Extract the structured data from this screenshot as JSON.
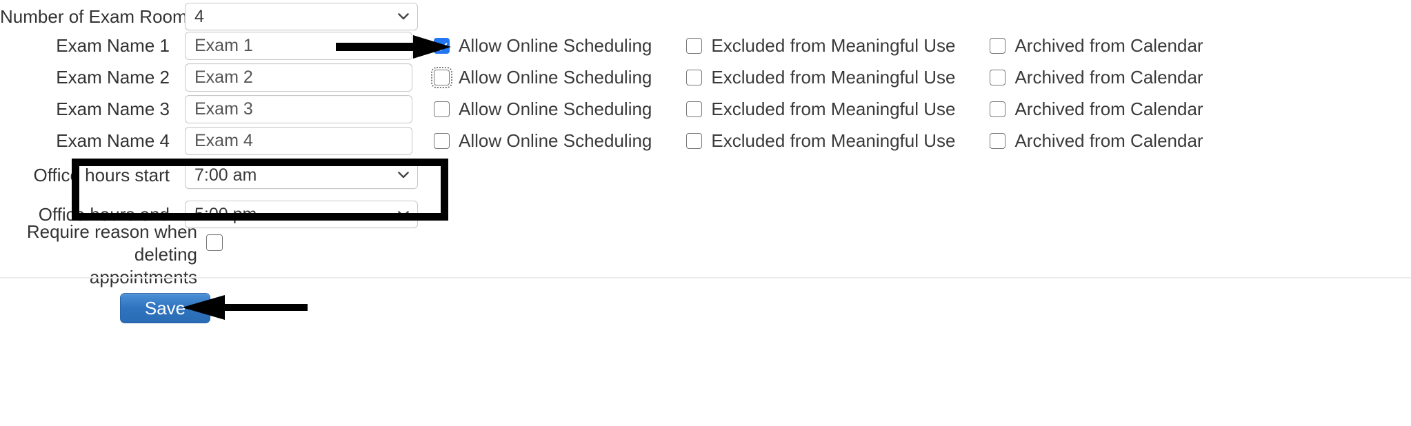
{
  "form": {
    "exam_rooms": {
      "label": "Number of Exam Rooms",
      "value": "4"
    },
    "exam_rows": [
      {
        "label": "Exam Name 1",
        "value": "Exam 1",
        "allow_online_label": "Allow Online Scheduling",
        "allow_online_checked": true,
        "allow_online_focused": false,
        "excluded_label": "Excluded from Meaningful Use",
        "excluded_checked": false,
        "archived_label": "Archived from Calendar",
        "archived_checked": false
      },
      {
        "label": "Exam Name 2",
        "value": "Exam 2",
        "allow_online_label": "Allow Online Scheduling",
        "allow_online_checked": false,
        "allow_online_focused": true,
        "excluded_label": "Excluded from Meaningful Use",
        "excluded_checked": false,
        "archived_label": "Archived from Calendar",
        "archived_checked": false
      },
      {
        "label": "Exam Name 3",
        "value": "Exam 3",
        "allow_online_label": "Allow Online Scheduling",
        "allow_online_checked": false,
        "allow_online_focused": false,
        "excluded_label": "Excluded from Meaningful Use",
        "excluded_checked": false,
        "archived_label": "Archived from Calendar",
        "archived_checked": false
      },
      {
        "label": "Exam Name 4",
        "value": "Exam 4",
        "allow_online_label": "Allow Online Scheduling",
        "allow_online_checked": false,
        "allow_online_focused": false,
        "excluded_label": "Excluded from Meaningful Use",
        "excluded_checked": false,
        "archived_label": "Archived from Calendar",
        "archived_checked": false
      }
    ],
    "office_hours_start": {
      "label": "Office hours start",
      "value": "7:00 am"
    },
    "office_hours_end": {
      "label": "Office hours end",
      "value": "5:00 pm"
    },
    "require_reason": {
      "label_line1": "Require reason when deleting",
      "label_line2": "appointments",
      "checked": false
    }
  },
  "actions": {
    "save_label": "Save"
  },
  "annotations": {
    "arrow_to_checkbox": "black-right-arrow",
    "arrow_to_save": "black-left-arrow",
    "highlight_box": "black-rectangle-around-office-hours"
  },
  "colors": {
    "checkbox_checked": "#2477f2",
    "save_button": "#2f73bf",
    "annotation": "#000000",
    "field_border": "#c8c8c8",
    "label_text": "#333333"
  },
  "icons": {
    "chevron_down": "chevron-down-icon",
    "check": "check-icon"
  }
}
